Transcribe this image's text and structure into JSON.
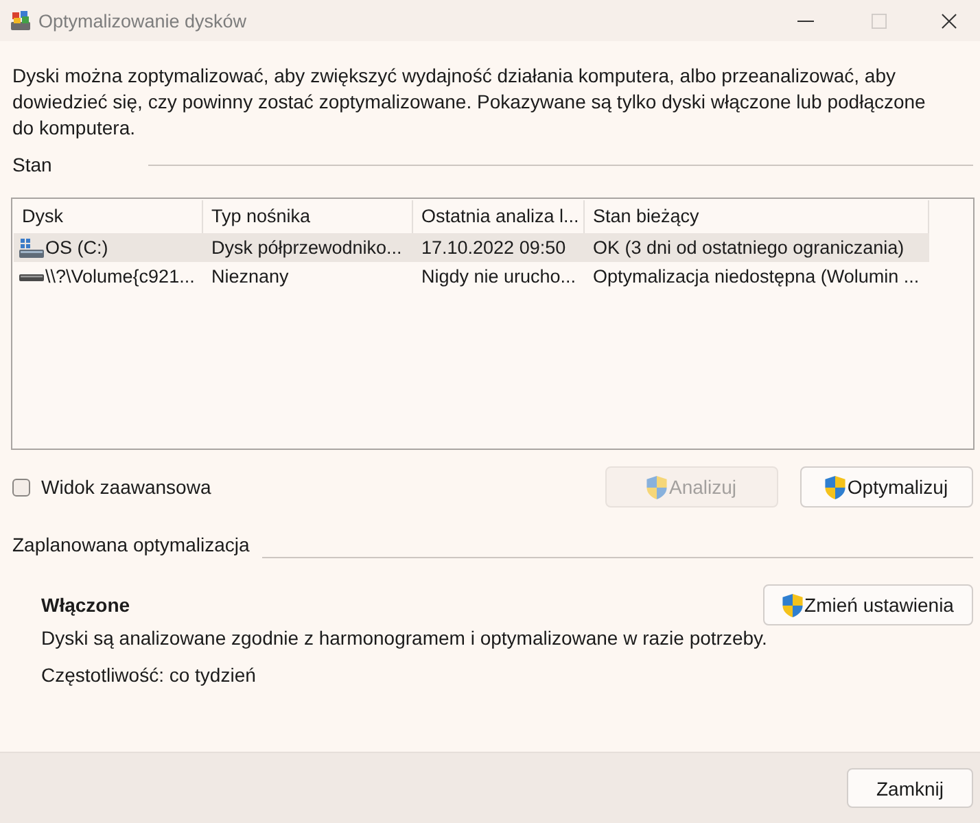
{
  "window": {
    "title": "Optymalizowanie dysków",
    "controls": [
      {
        "kind": "minimize",
        "disabled": false
      },
      {
        "kind": "maximize",
        "disabled": true
      },
      {
        "kind": "close",
        "disabled": false
      }
    ]
  },
  "description": "Dyski można zoptymalizować, aby zwiększyć wydajność działania komputera, albo przeanalizować, aby dowiedzieć się, czy powinny zostać zoptymalizowane. Pokazywane są tylko dyski włączone lub podłączone do komputera.",
  "status": {
    "heading": "Stan",
    "table": {
      "columns": [
        "Dysk",
        "Typ nośnika",
        "Ostatnia analiza l...",
        "Stan bieżący"
      ],
      "rows": [
        {
          "kind": "system",
          "selected": true,
          "cells": [
            "OS (C:)",
            "Dysk półprzewodniko...",
            "17.10.2022 09:50",
            "OK (3 dni od ostatniego ograniczania)"
          ]
        },
        {
          "kind": "drive",
          "selected": false,
          "cells": [
            "\\\\?\\Volume{c921...",
            "Nieznany",
            "Nigdy nie urucho...",
            "Optymalizacja niedostępna (Wolumin ..."
          ]
        }
      ]
    }
  },
  "advanced_view": {
    "label": "Widok zaawansowa",
    "checked": false
  },
  "actions": [
    {
      "label": "Analizuj",
      "disabled": true
    },
    {
      "label": "Optymalizuj",
      "disabled": false
    }
  ],
  "schedule": {
    "heading": "Zaplanowana optymalizacja",
    "status": "Włączone",
    "description": "Dyski są analizowane zgodnie z harmonogramem i optymalizowane w razie potrzeby.",
    "frequency": "Częstotliwość: co tydzień",
    "button": "Zmień ustawienia"
  },
  "close_button": "Zamknij"
}
